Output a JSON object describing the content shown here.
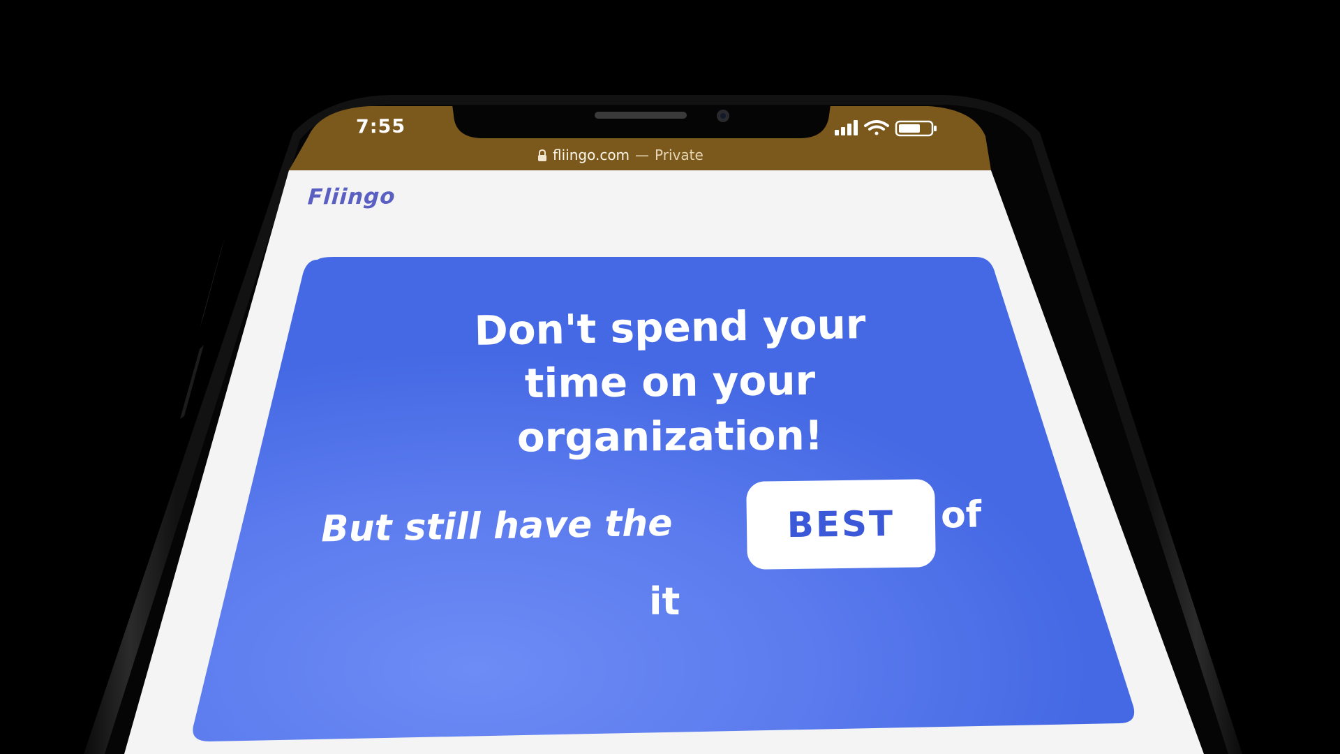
{
  "status_bar": {
    "time": "7:55",
    "icons": [
      "signal-icon",
      "wifi-icon",
      "battery-icon"
    ]
  },
  "browser": {
    "domain": "fliingo.com",
    "separator": "—",
    "mode": "Private",
    "lock_icon": "lock-icon"
  },
  "site": {
    "logo": "Fliingo"
  },
  "hero": {
    "line1": "Don't spend your",
    "line2": "time on your",
    "line3": "organization!",
    "sub_prefix": "But still have the",
    "sub_highlight": "BEST",
    "sub_suffix": "of",
    "sub_end": "it"
  },
  "colors": {
    "status_bar_bg": "#7b581c",
    "page_bg": "#f4f4f4",
    "hero_bg": "#4a6fe6",
    "hero_glow": "#6a86f2",
    "logo": "#5a5fc2",
    "best_text": "#3b58d8"
  }
}
